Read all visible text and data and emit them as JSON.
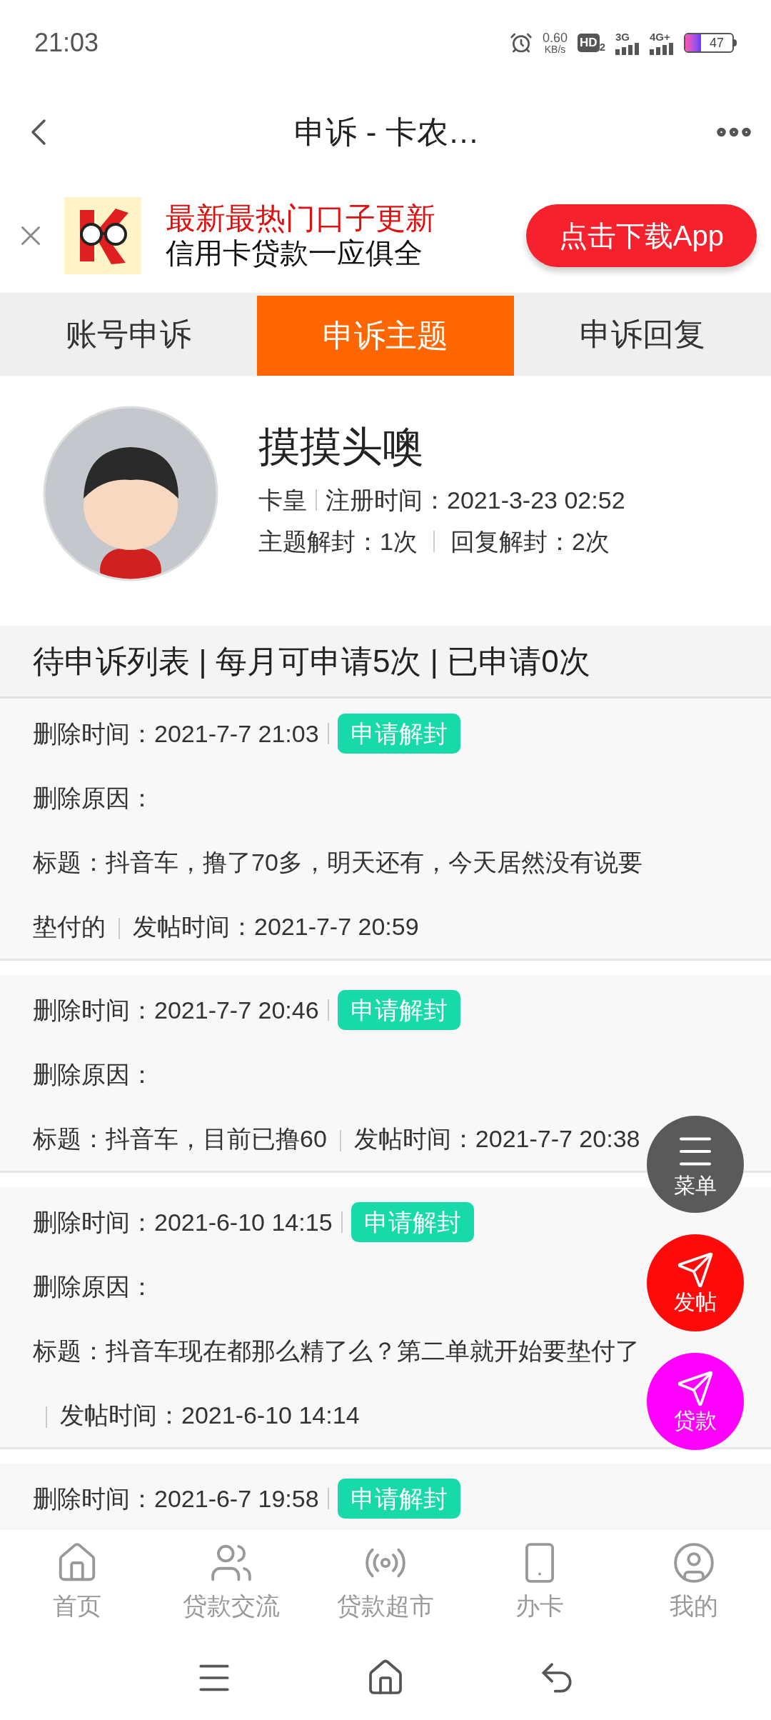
{
  "status_bar": {
    "time": "21:03",
    "speed": "0.60",
    "speed_unit": "KB/s",
    "hd": "HD",
    "hd_sub": "2",
    "net1": "3G",
    "net2": "4G+",
    "battery": "47"
  },
  "header": {
    "title": "申诉 - 卡农…"
  },
  "ad": {
    "headline": "最新最热门口子更新",
    "subline": "信用卡贷款一应俱全",
    "button": "点击下载App"
  },
  "tabs": [
    {
      "label": "账号申诉",
      "selected": false
    },
    {
      "label": "申诉主题",
      "selected": true
    },
    {
      "label": "申诉回复",
      "selected": false
    }
  ],
  "profile": {
    "name": "摸摸头噢",
    "rank": "卡皇",
    "registered": "注册时间：2021-3-23 02:52",
    "topic_unban": "主题解封：1次",
    "reply_unban": "回复解封：2次"
  },
  "list_header": "待申诉列表 | 每月可申请5次 | 已申请0次",
  "items": [
    {
      "delete_time": "删除时间：2021-7-7 21:03",
      "button": "申请解封",
      "reason": "删除原因：",
      "title": "标题：抖音车，撸了70多，明天还有，今天居然没有说要垫付的",
      "post_time": "发帖时间：2021-7-7 20:59"
    },
    {
      "delete_time": "删除时间：2021-7-7 20:46",
      "button": "申请解封",
      "reason": "删除原因：",
      "title": "标题：抖音车，目前已撸60",
      "post_time": "发帖时间：2021-7-7 20:38"
    },
    {
      "delete_time": "删除时间：2021-6-10 14:15",
      "button": "申请解封",
      "reason": "删除原因：",
      "title": "标题：抖音车现在都那么精了么？第二单就开始要垫付了",
      "post_time": "发帖时间：2021-6-10 14:14"
    },
    {
      "delete_time": "删除时间：2021-6-7 19:58",
      "button": "申请解封"
    }
  ],
  "fabs": [
    {
      "label": "菜单",
      "kind": "menu",
      "color": "#5a5a5a"
    },
    {
      "label": "发帖",
      "kind": "send",
      "color": "#ff0a0a"
    },
    {
      "label": "贷款",
      "kind": "send",
      "color": "#ff00ff"
    }
  ],
  "bottom_nav": [
    {
      "label": "首页",
      "kind": "home"
    },
    {
      "label": "贷款交流",
      "kind": "people"
    },
    {
      "label": "贷款超市",
      "kind": "signal"
    },
    {
      "label": "办卡",
      "kind": "phone"
    },
    {
      "label": "我的",
      "kind": "user"
    }
  ]
}
